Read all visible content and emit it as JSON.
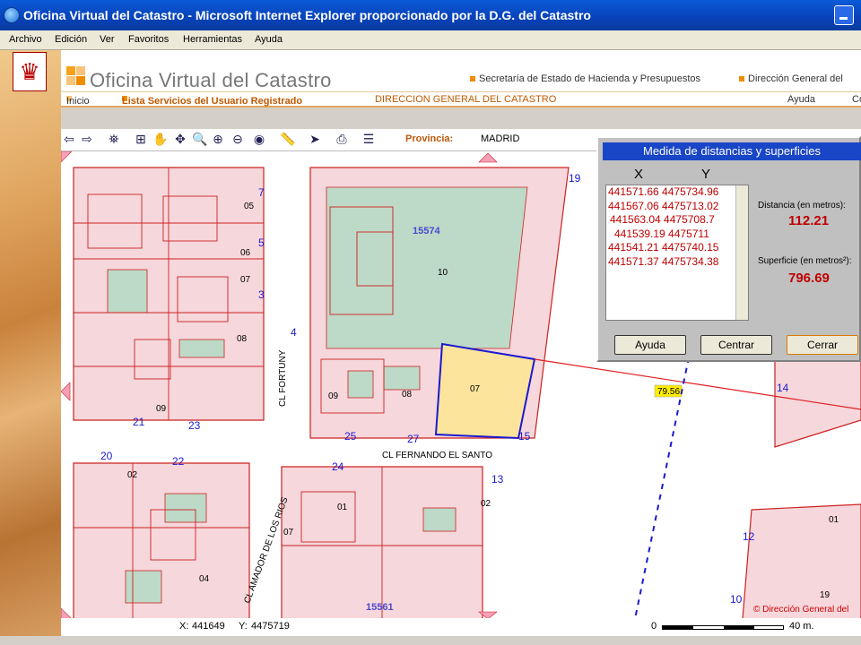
{
  "window": {
    "title": "Oficina Virtual del Catastro - Microsoft Internet Explorer proporcionado por la D.G. del Catastro"
  },
  "menu": [
    "Archivo",
    "Edición",
    "Ver",
    "Favoritos",
    "Herramientas",
    "Ayuda"
  ],
  "header": {
    "logo_text": "Oficina Virtual del Catastro",
    "link1": "Secretaría de Estado de Hacienda y Presupuestos",
    "link2": "Dirección General del"
  },
  "nav": {
    "inicio": "Inicio",
    "servicios": "Lista Servicios del Usuario Registrado",
    "direccion": "DIRECCION GENERAL DEL CATASTRO",
    "ayuda": "Ayuda",
    "co": "Co"
  },
  "toolbar": {
    "provincia_label": "Provincia:",
    "provincia_value": "MADRID"
  },
  "map": {
    "labels": {
      "block1": "15574",
      "block2": "15561",
      "street1": "CL FORTUNY",
      "street2": "CL FERNANDO EL SANTO",
      "street3": "CL AMADOR DE LOS RIOS",
      "measure_label": "79.56",
      "copyright": "© Dirección General del",
      "n05": "05",
      "n06": "06",
      "n07": "07",
      "n08": "08",
      "n09": "09",
      "n10": "10",
      "n09b": "09",
      "n08b": "08",
      "n07b": "07",
      "n02": "02",
      "n04": "04",
      "n01": "01",
      "n07c": "07",
      "n02b": "02",
      "n01b": "01",
      "n19": "19",
      "s7": "7",
      "s5": "5",
      "s3": "3",
      "s4": "4",
      "s21": "21",
      "s23": "23",
      "s25": "25",
      "s27": "27",
      "s15": "15",
      "s19": "19",
      "s14": "14",
      "s20": "20",
      "s22": "22",
      "s24": "24",
      "s13": "13",
      "s12": "12",
      "s10": "10"
    }
  },
  "status": {
    "x_label": "X:",
    "x_value": "441649",
    "y_label": "Y:",
    "y_value": "4475719",
    "scale_start": "0",
    "scale_end": "40 m."
  },
  "measure_panel": {
    "title": "Medida de distancias y superficies",
    "col_x": "X",
    "col_y": "Y",
    "coords": [
      "441571.66 4475734.96",
      "441567.06 4475713.02",
      "441563.04 4475708.7",
      "441539.19 4475711",
      "441541.21 4475740.15",
      "441571.37 4475734.38"
    ],
    "distance_label": "Distancia (en metros):",
    "distance_value": "112.21",
    "area_label": "Superficie (en metros²):",
    "area_value": "796.69",
    "btn_help": "Ayuda",
    "btn_center": "Centrar",
    "btn_close": "Cerrar"
  }
}
